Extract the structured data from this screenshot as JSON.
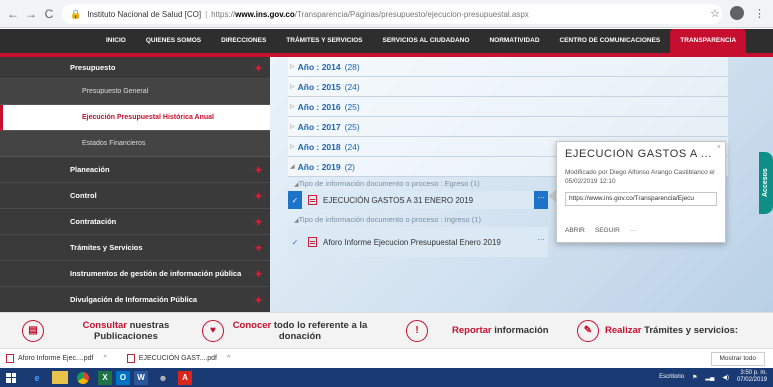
{
  "browser": {
    "back": "←",
    "forward": "→",
    "reload": "C",
    "lock": "🔒",
    "site_label": "Instituto Nacional de Salud [CO]",
    "separator": "|",
    "url_scheme": "https://",
    "url_host": "www.ins.gov.co",
    "url_path": "/Transparencia/Paginas/presupuesto/ejecucion-presupuestal.aspx",
    "star": "☆"
  },
  "site_nav": {
    "items": [
      "INICIO",
      "QUIENES SOMOS",
      "DIRECCIONES",
      "TRÁMITES Y SERVICIOS",
      "SERVICIOS AL CIUDADANO",
      "NORMATIVIDAD",
      "CENTRO DE COMUNICACIONES",
      "TRANSPARENCIA"
    ],
    "active_index": 7
  },
  "sidebar": {
    "presupuesto": "Presupuesto",
    "presupuesto_general": "Presupuesto General",
    "ejecucion_historica": "Ejecución Presupuestal Histórica Anual",
    "estados_financieros": "Estados Financieros",
    "planeacion": "Planeación",
    "control": "Control",
    "contratacion": "Contratación",
    "tramites": "Trámites y Servicios",
    "instrumentos": "Instrumentos de gestión de información pública",
    "divulgacion": "Divulgación de Información Pública",
    "plus": "+"
  },
  "years": [
    {
      "label": "Año : 2014",
      "count": "(28)"
    },
    {
      "label": "Año : 2015",
      "count": "(24)"
    },
    {
      "label": "Año : 2016",
      "count": "(25)"
    },
    {
      "label": "Año : 2017",
      "count": "(25)"
    },
    {
      "label": "Año : 2018",
      "count": "(24)"
    },
    {
      "label": "Año : 2019",
      "count": "(2)"
    }
  ],
  "documents": {
    "egreso_header": "Tipo de información documento o proceso : Egreso (1)",
    "egreso_doc": "EJECUCIÓN GASTOS A 31 ENERO 2019",
    "ingreso_header": "Tipo de información documento o proceso : Ingreso (1)",
    "ingreso_doc": "Aforo Informe Ejecucion Presupuestal Enero 2019",
    "more": "…",
    "check": "✓"
  },
  "callout": {
    "title": "EJECUCIÓN GASTOS A ...",
    "modified": "Modificado por Diego Alfonso Arango Castiblanco el 05/02/2019 12:10",
    "link": "https://www.ins.gov.co/Transparencia/Ejecu",
    "open": "ABRIR",
    "follow": "SEGUIR",
    "more": "···",
    "close": "×"
  },
  "accessibility": "Accesos",
  "promo": {
    "consultar_red": "Consultar",
    "consultar_rest": "nuestras Publicaciones",
    "conocer_red": "Conocer",
    "conocer_rest": "todo lo referente a la donación",
    "reportar_red": "Reportar",
    "reportar_rest": "información",
    "realizar_red": "Realizar",
    "realizar_rest": "Trámites y servicios:"
  },
  "downloads": {
    "item1": "Aforo Informe Ejec....pdf",
    "item2": "EJECUCIÓN GAST....pdf",
    "caret": "^",
    "show_all": "Mostrar todo"
  },
  "taskbar": {
    "desktop_label": "Escritorio",
    "time": "3:50 p. m.",
    "date": "07/02/2019"
  }
}
